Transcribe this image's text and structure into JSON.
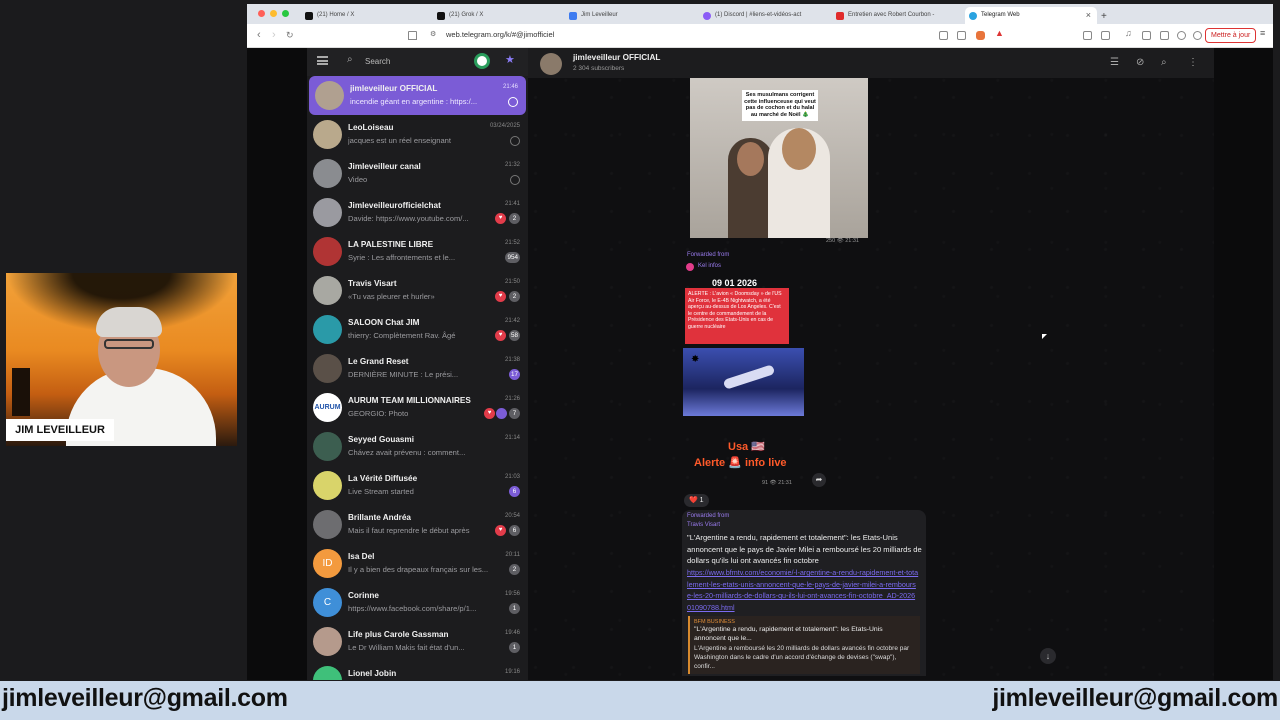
{
  "browser": {
    "tabs": [
      {
        "label": "(21) Home / X",
        "active": false
      },
      {
        "label": "(21) Grok / X",
        "active": false
      },
      {
        "label": "Jim Leveilleur",
        "active": false
      },
      {
        "label": "(1) Discord | #liens-et-vidéos-act",
        "active": false
      },
      {
        "label": "Entretien avec Robert Courbon -",
        "active": false
      },
      {
        "label": "Telegram Web",
        "active": true
      }
    ],
    "url": "web.telegram.org/k/#@jimofficiel",
    "update_button": "Mettre à jour",
    "new_tab": "+"
  },
  "sidebar": {
    "search_placeholder": "Search",
    "chats": [
      {
        "name": "jimleveilleur OFFICIAL",
        "preview": "incendie géant en argentine : https:/...",
        "time": "21:46",
        "active": true
      },
      {
        "name": "LeoLoiseau",
        "preview": "jacques est un réel enseignant",
        "time": "03/24/2025"
      },
      {
        "name": "Jimleveilleur canal",
        "preview": "Video",
        "time": "21:32"
      },
      {
        "name": "Jimleveilleurofficielchat",
        "preview": "Davide: https://www.youtube.com/...",
        "time": "21:41",
        "badge": "2",
        "heart": true
      },
      {
        "name": "LA PALESTINE LIBRE",
        "preview": "Syrie : Les affrontements et le...",
        "time": "21:52",
        "badge": "954"
      },
      {
        "name": "Travis Visart",
        "preview": "«Tu vas pleurer et hurler»",
        "time": "21:50",
        "badge": "2",
        "heart": true
      },
      {
        "name": "SALOON Chat JIM",
        "preview": "thierry: Complètement Rav. Âgé",
        "time": "21:42",
        "badge": "58",
        "heart": true
      },
      {
        "name": "Le Grand Reset",
        "preview": "DERNIÈRE MINUTE : Le prési...",
        "time": "21:38",
        "badge": "17",
        "badge_purple": true
      },
      {
        "name": "AURUM TEAM MILLIONNAIRES",
        "preview": "GEORGIO: Photo",
        "time": "21:26",
        "badge": "7",
        "heart": true,
        "pin": true
      },
      {
        "name": "Seyyed Gouasmi",
        "preview": "Chávez avait prévenu : comment...",
        "time": "21:14"
      },
      {
        "name": "La Vérité Diffusée",
        "preview": "Live Stream started",
        "time": "21:03",
        "badge": "6",
        "badge_purple": true
      },
      {
        "name": "Brillante Andréa",
        "preview": "Mais il faut reprendre le début après",
        "time": "20:54",
        "badge": "6",
        "heart": true
      },
      {
        "name": "Isa Del",
        "preview": "Il y a bien des drapeaux français sur les...",
        "time": "20:11",
        "badge": "2",
        "initials": "ID"
      },
      {
        "name": "Corinne",
        "preview": "https://www.facebook.com/share/p/1...",
        "time": "19:56",
        "badge": "1",
        "initials": "C"
      },
      {
        "name": "Life plus Carole Gassman",
        "preview": "Le Dr William Makis fait état d'un...",
        "time": "19:46",
        "badge": "1"
      },
      {
        "name": "Lionel Jobin",
        "preview": "",
        "time": "19:16"
      }
    ]
  },
  "header": {
    "title": "jimleveilleur OFFICIAL",
    "subscribers": "2 304 subscribers"
  },
  "messages": {
    "img1_caption": "Ses musulmans corrigent cette influenceuse qui veut pas de cochon et du halal au marché de Noël 🎄",
    "img1_meta": "250 👁 21:31",
    "fwd_label": "Forwarded from",
    "fwd1_name": "Kel infos",
    "alert_date": "09 01 2026",
    "alert_text": "ALERTE : L'avion « Doomsday » de l'US Air Force, le E-4B Nightwatch, a été aperçu au-dessus de Los Angeles. C'est le centre de commandement de la Présidence des Etats-Unis en cas de guerre nucléaire",
    "usa": "Usa 🇺🇸",
    "alerte": "Alerte 🚨 info live",
    "alert_meta": "91 👁 21:31",
    "reaction": "❤️ 1",
    "fwd2_name": "Travis Visart",
    "text_body": "\"L'Argentine a rendu, rapidement et totalement\": les Etats-Unis annoncent que le pays de Javier Milei a remboursé les 20 milliards de dollars qu'ils lui ont avancés fin octobre",
    "link": "https://www.bfmtv.com/economie/-l-argentine-a-rendu-rapidement-et-totalement-les-etats-unis-annoncent-que-le-pays-de-javier-milei-a-rembourse-les-20-milliards-de-dollars-qu-ils-lui-ont-avances-fin-octobre_AD-202601090788.html",
    "preview_source": "BFM BUSINESS",
    "preview_title": "\"L'Argentine a rendu, rapidement et totalement\": les Etats-Unis annoncent que le...",
    "preview_desc": "L'Argentine a remboursé les 20 milliards de dollars avancés fin octobre par Washington dans le cadre d'un accord d'échange de devises (\"swap\"), confir..."
  },
  "overlay": {
    "name": "JIM LEVEILLEUR",
    "email_left": "jimleveilleur@gmail.com",
    "email_right": "jimleveilleur@gmail.com"
  },
  "colors": {
    "accent": "#7b5cd6",
    "alert_red": "#e0323c",
    "email_bar": "#c9d8ea"
  }
}
